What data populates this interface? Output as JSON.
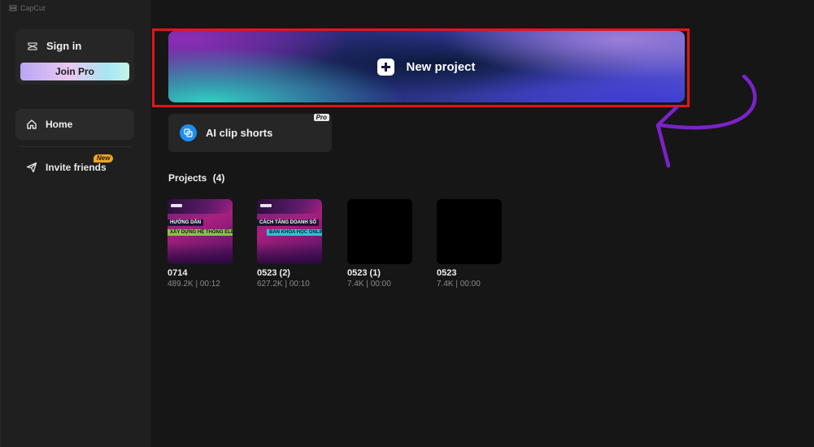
{
  "app": {
    "title": "CapCut"
  },
  "sidebar": {
    "sign_in_label": "Sign in",
    "join_pro_label": "Join Pro",
    "items": [
      {
        "label": "Home",
        "icon": "home-icon",
        "active": true
      },
      {
        "label": "Invite friends",
        "icon": "send-icon",
        "badge": "New"
      }
    ]
  },
  "main": {
    "new_project_label": "New project",
    "ai_clip_shorts": {
      "label": "AI clip shorts",
      "badge": "Pro"
    },
    "projects_heading": "Projects",
    "projects_count": "(4)",
    "projects": [
      {
        "name": "0714",
        "meta": "489.2K | 00:12",
        "thumb_line1": "HƯỚNG DẪN",
        "thumb_line2": "XÂY DỰNG HỆ THỐNG ELEARNIN"
      },
      {
        "name": "0523 (2)",
        "meta": "627.2K | 00:10",
        "thumb_line1": "CÁCH TĂNG DOANH SỐ",
        "thumb_line2": "BÁN KHÓA HỌC ONLINE"
      },
      {
        "name": "0523 (1)",
        "meta": "7.4K | 00:00"
      },
      {
        "name": "0523",
        "meta": "7.4K | 00:00"
      }
    ]
  },
  "colors": {
    "highlight": "#e3141b",
    "annotation_arrow": "#7b22c9",
    "new_badge": "#f5a623",
    "ai_icon": "#1d8ff0"
  }
}
